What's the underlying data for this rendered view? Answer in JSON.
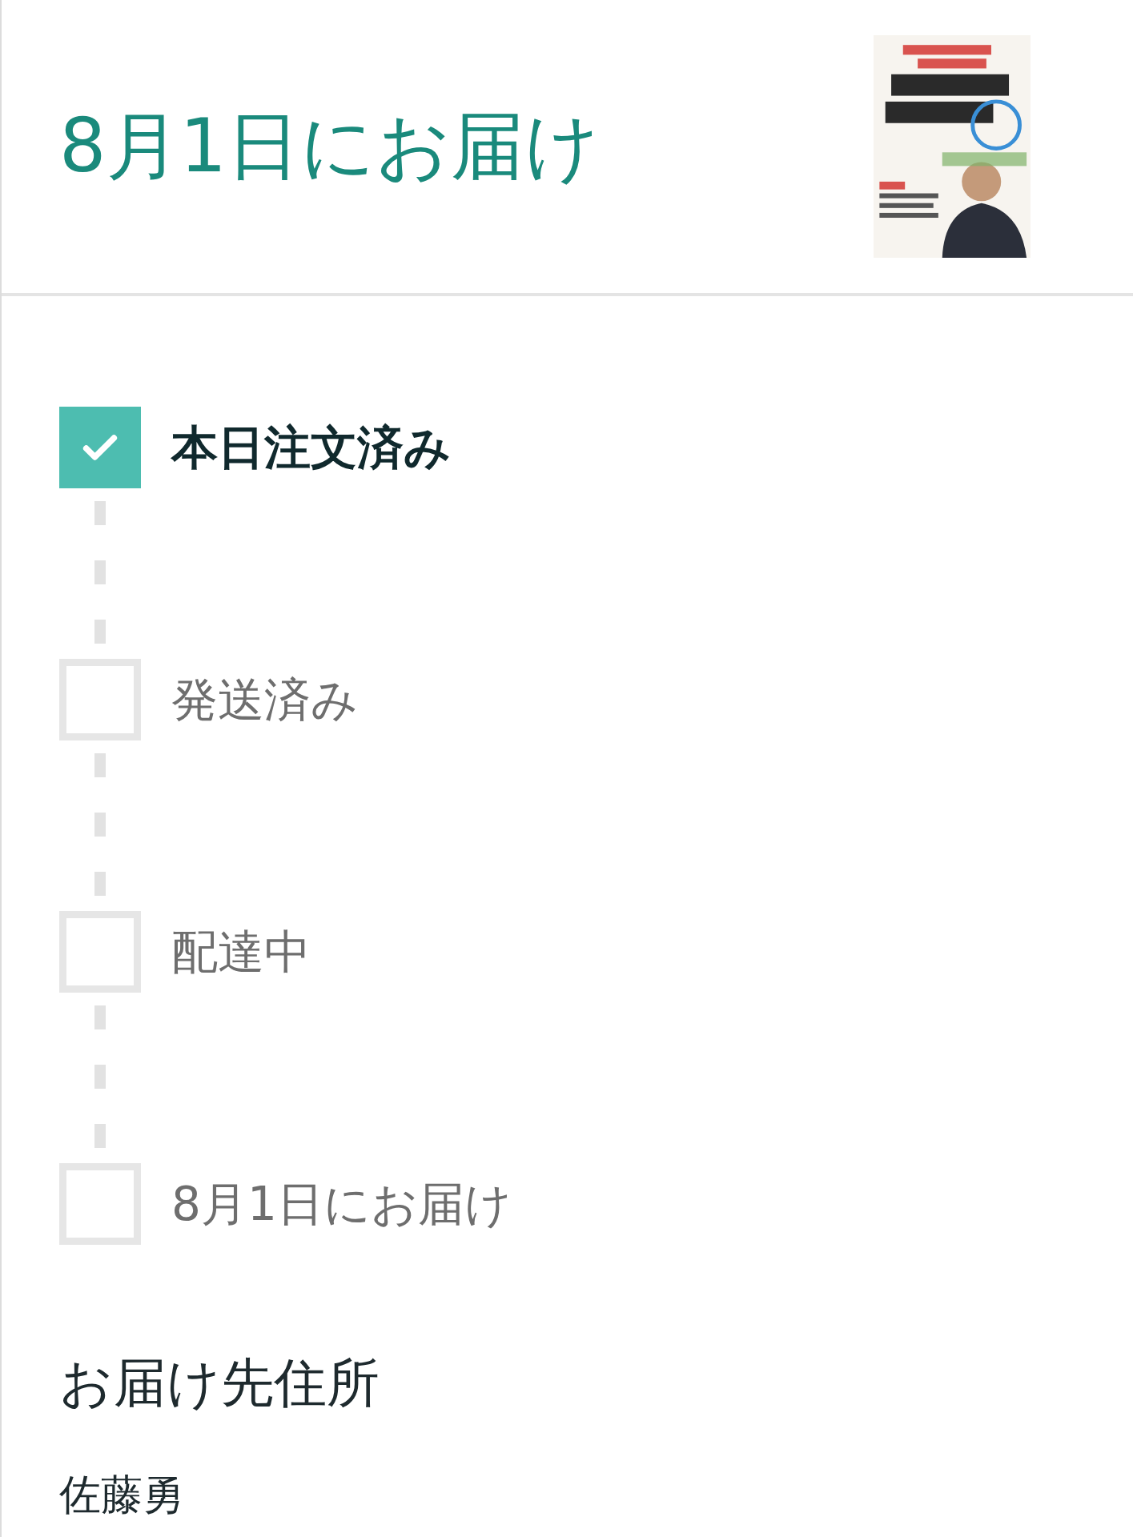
{
  "header": {
    "title": "8月1日にお届け"
  },
  "steps": [
    {
      "label": "本日注文済み",
      "checked": true
    },
    {
      "label": "発送済み",
      "checked": false
    },
    {
      "label": "配達中",
      "checked": false
    },
    {
      "label": "8月1日にお届け",
      "checked": false
    }
  ],
  "address": {
    "heading": "お届け先住所",
    "name": "佐藤勇"
  }
}
